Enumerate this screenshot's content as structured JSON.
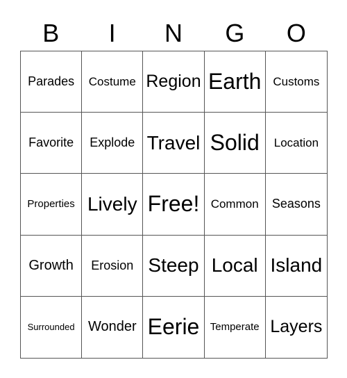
{
  "header": {
    "letters": [
      "B",
      "I",
      "N",
      "G",
      "O"
    ]
  },
  "cells": [
    [
      "Parades",
      "Costume",
      "Region",
      "Earth",
      "Customs"
    ],
    [
      "Favorite",
      "Explode",
      "Travel",
      "Solid",
      "Location"
    ],
    [
      "Properties",
      "Lively",
      "Free!",
      "Common",
      "Seasons"
    ],
    [
      "Growth",
      "Erosion",
      "Steep",
      "Local",
      "Island"
    ],
    [
      "Surrounded",
      "Wonder",
      "Eerie",
      "Temperate",
      "Layers"
    ]
  ]
}
